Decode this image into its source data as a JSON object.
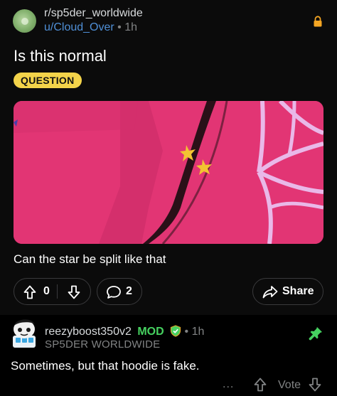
{
  "post": {
    "subreddit": "r/sp5der_worldwide",
    "author": "u/Cloud_Over",
    "time": "1h",
    "title": "Is this normal",
    "flair": "QUESTION",
    "body": "Can the star be split like that",
    "votes": "0",
    "comments": "2",
    "share_label": "Share",
    "icons": {
      "subreddit": "subreddit-avatar",
      "locked": "lock-icon",
      "upvote": "arrow-up-icon",
      "downvote": "arrow-down-icon",
      "comment": "comment-bubble-icon",
      "share": "share-arrow-icon"
    },
    "colors": {
      "flair": "#f3d34a",
      "author": "#4f8fd6"
    }
  },
  "comment": {
    "username": "reezyboost350v2",
    "badge": "MOD",
    "time": "1h",
    "community": "SP5DER WORLDWIDE",
    "text": "Sometimes, but that hoodie is fake.",
    "more": "...",
    "vote_label": "Vote",
    "icons": {
      "avatar": "user-avatar",
      "mod": "mod-shield-icon",
      "pinned": "pin-icon"
    },
    "colors": {
      "mod": "#46d160",
      "pin": "#46d160"
    }
  }
}
